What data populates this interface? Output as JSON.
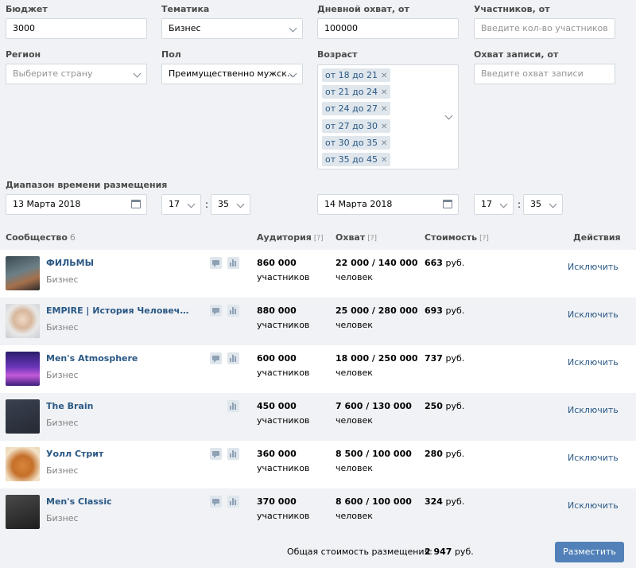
{
  "filters": {
    "budget_label": "Бюджет",
    "budget_value": "3000",
    "topic_label": "Тематика",
    "topic_value": "Бизнес",
    "daily_reach_label": "Дневной охват, от",
    "daily_reach_value": "100000",
    "members_label": "Участников, от",
    "members_placeholder": "Введите кол-во участников",
    "region_label": "Регион",
    "region_placeholder": "Выберите страну",
    "gender_label": "Пол",
    "gender_value": "Преимущественно мужск…",
    "age_label": "Возраст",
    "age_tags": [
      "от 18 до 21",
      "от 21 до 24",
      "от 24 до 27",
      "от 27 до 30",
      "от 30 до 35",
      "от 35 до 45"
    ],
    "post_reach_label": "Охват записи, от",
    "post_reach_placeholder": "Введите охват записи",
    "time_range_label": "Диапазон времени размещения",
    "start_date": "13 Марта 2018",
    "start_hour": "17",
    "start_min": "35",
    "end_date": "14 Марта 2018",
    "end_hour": "17",
    "end_min": "35",
    "time_sep": ":"
  },
  "table": {
    "col_community": "Сообщество",
    "community_count": "6",
    "col_audience": "Аудитория",
    "col_reach": "Охват",
    "col_cost": "Стоимость",
    "help_mark": "[?]",
    "col_actions": "Действия",
    "rows": [
      {
        "name": "ФИЛЬМЫ",
        "category": "Бизнес",
        "audience": "860 000",
        "audience_unit": "участников",
        "reach": "22 000 / 140 000",
        "reach_unit": "человек",
        "price": "663",
        "currency": "руб.",
        "action": "Исключить",
        "has_comments": true
      },
      {
        "name": "EMPIRE | История Человеч…",
        "category": "Бизнес",
        "audience": "880 000",
        "audience_unit": "участников",
        "reach": "25 000 / 280 000",
        "reach_unit": "человек",
        "price": "693",
        "currency": "руб.",
        "action": "Исключить",
        "has_comments": true
      },
      {
        "name": "Men's Atmosphere",
        "category": "Бизнес",
        "audience": "600 000",
        "audience_unit": "участников",
        "reach": "18 000 / 250 000",
        "reach_unit": "человек",
        "price": "737",
        "currency": "руб.",
        "action": "Исключить",
        "has_comments": true
      },
      {
        "name": "The Brain",
        "category": "Бизнес",
        "audience": "450 000",
        "audience_unit": "участников",
        "reach": "7 600 / 130 000",
        "reach_unit": "человек",
        "price": "250",
        "currency": "руб.",
        "action": "Исключить",
        "has_comments": false
      },
      {
        "name": "Уолл Стрит",
        "category": "Бизнес",
        "audience": "360 000",
        "audience_unit": "участников",
        "reach": "8 500 / 100 000",
        "reach_unit": "человек",
        "price": "280",
        "currency": "руб.",
        "action": "Исключить",
        "has_comments": true
      },
      {
        "name": "Men's Classic",
        "category": "Бизнес",
        "audience": "370 000",
        "audience_unit": "участников",
        "reach": "8 600 / 100 000",
        "reach_unit": "человек",
        "price": "324",
        "currency": "руб.",
        "action": "Исключить",
        "has_comments": true
      }
    ]
  },
  "footer": {
    "total_label": "Общая стоимость размещения:",
    "total_value": "2 947",
    "total_currency": "руб.",
    "place_button": "Разместить"
  },
  "colors": {
    "link": "#2a5885",
    "button": "#5181b8",
    "background": "#f0f2f5"
  }
}
